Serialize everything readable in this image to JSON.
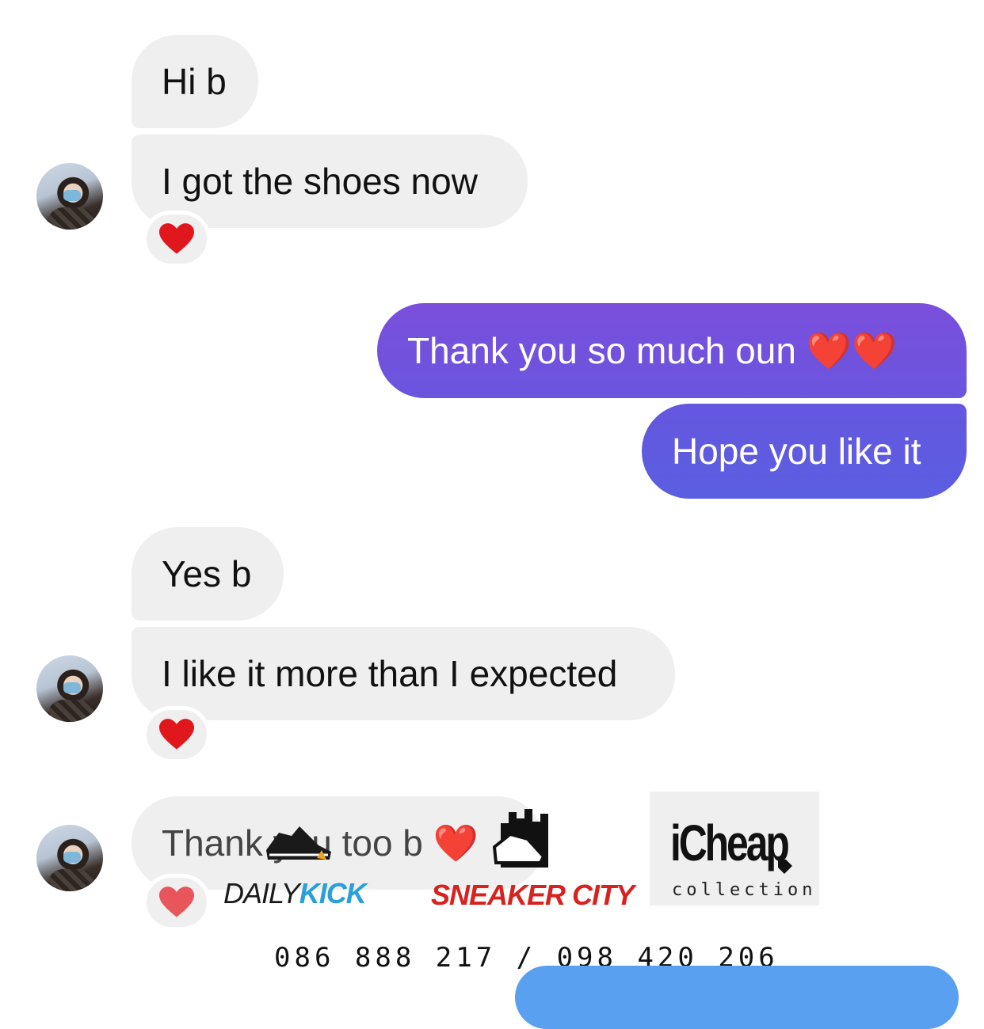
{
  "conversation": {
    "messages": [
      {
        "side": "received",
        "text": "Hi b"
      },
      {
        "side": "received",
        "text": "I got the shoes now",
        "reaction": "❤️"
      },
      {
        "side": "sent",
        "text": "Thank you so much oun ❤️❤️"
      },
      {
        "side": "sent",
        "text": "Hope you like it"
      },
      {
        "side": "received",
        "text": "Yes b"
      },
      {
        "side": "received",
        "text": "I like it more than I expected",
        "reaction": "❤️"
      },
      {
        "side": "received",
        "text": "Thank you too b ❤️",
        "reaction": "❤️"
      }
    ]
  },
  "watermark": {
    "daily_kick_prefix": "DAILY",
    "daily_kick_suffix": "KICK",
    "sneaker_city": "SNEAKER CITY",
    "icheap_name": "iCheap",
    "icheap_sub": "collection",
    "phones": "086 888 217  /  098 420 206"
  },
  "colors": {
    "received_bubble": "#efefef",
    "sent_gradient_top": "#7a4fdc",
    "sent_gradient_bottom": "#5b5ee0",
    "partial_bubble": "#5aa0f0",
    "heart": "#e0171c"
  }
}
